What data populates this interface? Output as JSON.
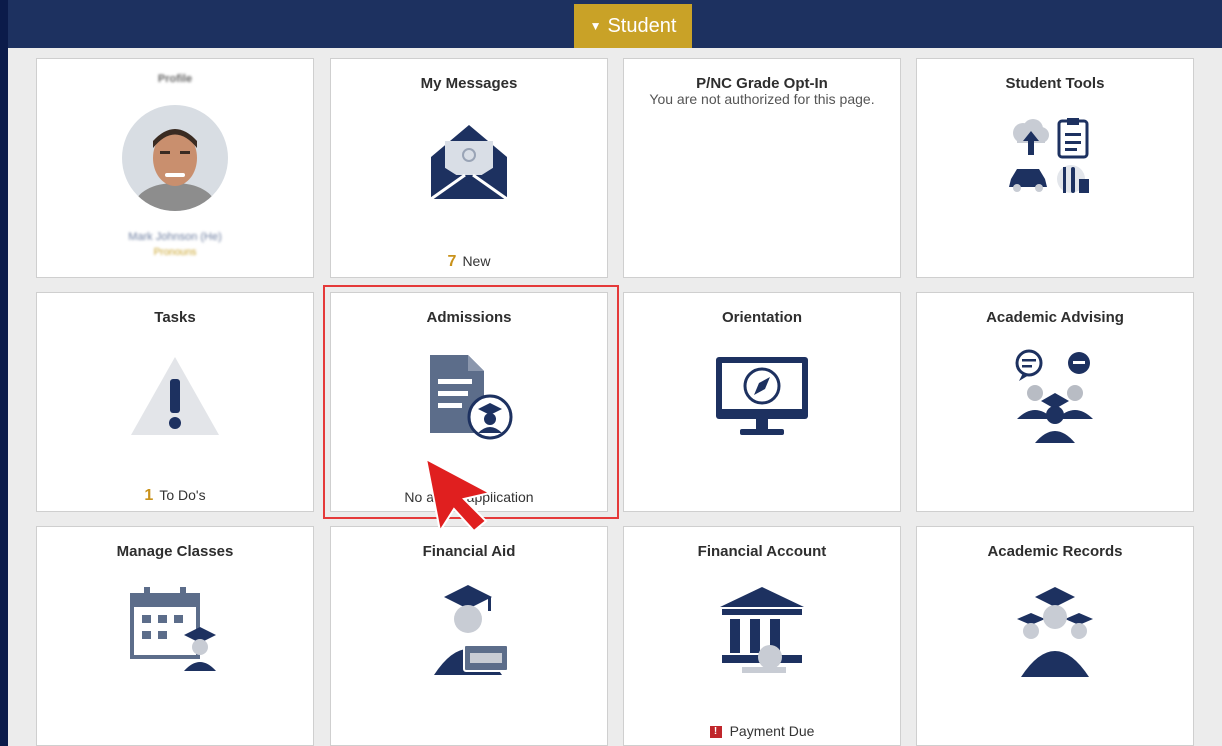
{
  "header": {
    "menu_label": "Student"
  },
  "profile": {
    "name": "Profile",
    "full_name": "Mark Johnson (He)",
    "pronouns": "Pronouns"
  },
  "tiles": {
    "my_messages": {
      "title": "My Messages",
      "count": "7",
      "count_label": "New"
    },
    "pnc": {
      "title": "P/NC Grade Opt-In",
      "message": "You are not authorized for this page."
    },
    "student_tools": {
      "title": "Student Tools"
    },
    "tasks": {
      "title": "Tasks",
      "count": "1",
      "count_label": "To Do's"
    },
    "admissions": {
      "title": "Admissions",
      "footer": "No active application"
    },
    "orientation": {
      "title": "Orientation"
    },
    "academic_advising": {
      "title": "Academic Advising"
    },
    "manage_classes": {
      "title": "Manage Classes"
    },
    "financial_aid": {
      "title": "Financial Aid"
    },
    "financial_account": {
      "title": "Financial Account",
      "footer": "Payment Due"
    },
    "academic_records": {
      "title": "Academic Records"
    }
  },
  "colors": {
    "navy": "#1d3160",
    "gold": "#c9a227",
    "icon": "#1d3160",
    "highlight": "#e53a3a"
  }
}
